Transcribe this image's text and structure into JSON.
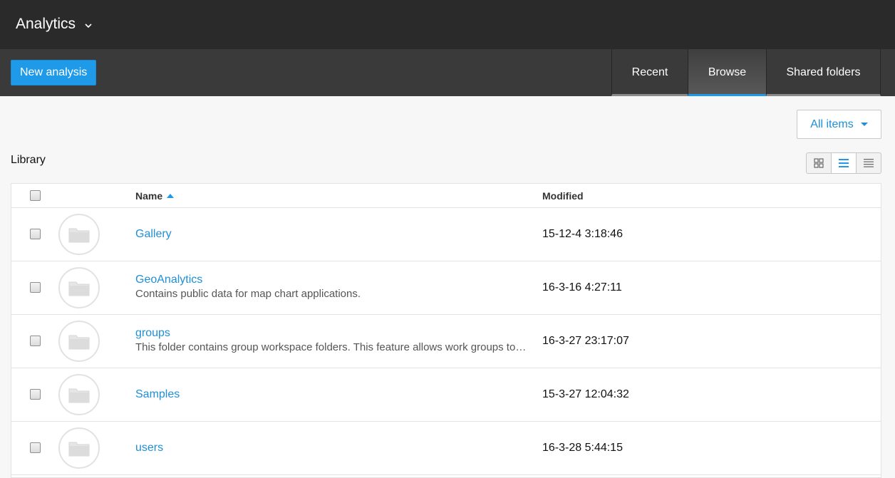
{
  "app": {
    "title": "Analytics"
  },
  "toolbar": {
    "new_label": "New analysis"
  },
  "tabs": [
    {
      "label": "Recent",
      "active": false
    },
    {
      "label": "Browse",
      "active": true
    },
    {
      "label": "Shared folders",
      "active": false
    }
  ],
  "filter": {
    "label": "All items"
  },
  "library": {
    "label": "Library"
  },
  "view_modes": {
    "options": [
      "grid-view-icon",
      "list-view-icon",
      "compact-list-icon"
    ],
    "active": "list-view-icon"
  },
  "table": {
    "columns": {
      "name": "Name",
      "modified": "Modified"
    },
    "sort": {
      "column": "Name",
      "direction": "ascending"
    },
    "rows": [
      {
        "name": "Gallery",
        "description": "",
        "modified": "15-12-4 3:18:46"
      },
      {
        "name": "GeoAnalytics",
        "description": "Contains public data for map chart applications.",
        "modified": "16-3-16 4:27:11"
      },
      {
        "name": "groups",
        "description": "This folder contains group workspace folders. This feature allows work groups to share content.",
        "modified": "16-3-27 23:17:07"
      },
      {
        "name": "Samples",
        "description": "",
        "modified": "15-3-27 12:04:32"
      },
      {
        "name": "users",
        "description": "",
        "modified": "16-3-28 5:44:15"
      }
    ]
  },
  "colors": {
    "accent": "#1f9ae8",
    "header_bg": "#2a2a2a",
    "toolbar_bg": "#3a3a3a",
    "link": "#1f8fd6"
  }
}
